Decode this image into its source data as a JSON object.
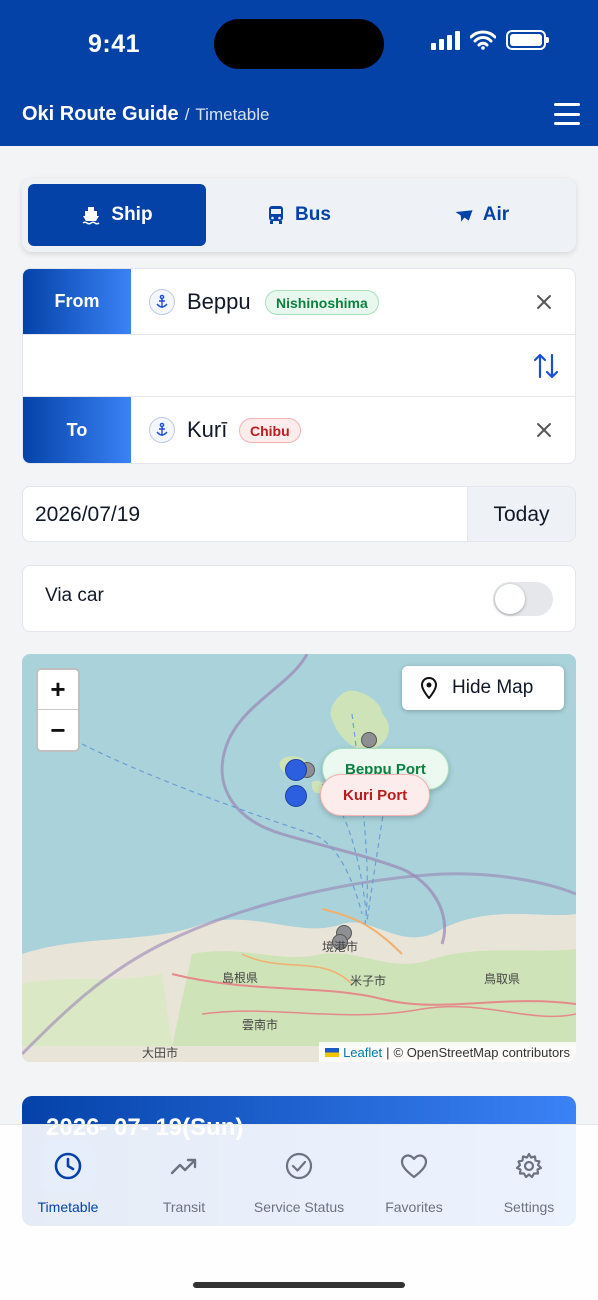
{
  "status_bar": {
    "time": "9:41"
  },
  "header": {
    "title": "Oki Route Guide",
    "separator": "/",
    "subtitle": "Timetable",
    "menu_icon": "hamburger-icon"
  },
  "modes": [
    {
      "label": "Ship",
      "icon": "ship-icon",
      "active": true
    },
    {
      "label": "Bus",
      "icon": "bus-icon",
      "active": false
    },
    {
      "label": "Air",
      "icon": "plane-icon",
      "active": false
    }
  ],
  "route": {
    "from": {
      "label": "From",
      "port": "Beppu",
      "island": "Nishinoshima"
    },
    "to": {
      "label": "To",
      "port": "Kurī",
      "island": "Chibu"
    }
  },
  "date": {
    "value": "2026/07/19",
    "today_label": "Today"
  },
  "via_car": {
    "label": "Via car",
    "enabled": false
  },
  "map": {
    "hide_label": "Hide Map",
    "zoom_in": "+",
    "zoom_out": "−",
    "popups": [
      "Beppu Port",
      "Kuri Port"
    ],
    "place_labels": [
      "島根県",
      "鳥取県",
      "米子市",
      "雲南市",
      "大田市",
      "境港市"
    ],
    "attribution_leaflet": "Leaflet",
    "attribution_sep": "|",
    "attribution_osm": "© OpenStreetMap contributors"
  },
  "result": {
    "date_header": "2026- 07- 19(Sun)"
  },
  "tabs": [
    {
      "label": "Timetable",
      "icon": "clock-icon",
      "active": true
    },
    {
      "label": "Transit",
      "icon": "trend-icon",
      "active": false
    },
    {
      "label": "Service Status",
      "icon": "check-circle-icon",
      "active": false
    },
    {
      "label": "Favorites",
      "icon": "heart-icon",
      "active": false
    },
    {
      "label": "Settings",
      "icon": "gear-icon",
      "active": false
    }
  ],
  "colors": {
    "primary": "#0442a8",
    "accent": "#3b82f6",
    "green": "#0d8040",
    "red": "#c01c1c"
  }
}
